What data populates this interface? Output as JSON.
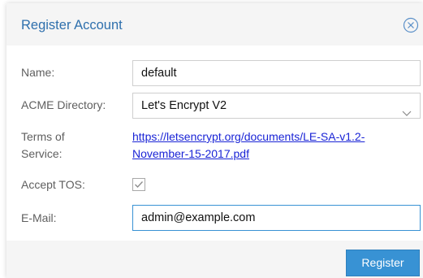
{
  "dialog": {
    "title": "Register Account",
    "close_icon": "close-circle-icon"
  },
  "form": {
    "name_label": "Name:",
    "name_value": "default",
    "acme_label": "ACME Directory:",
    "acme_value": "Let's Encrypt V2",
    "acme_arrow_icon": "chevron-down-icon",
    "tos_label_line1": "Terms of",
    "tos_label_line2": "Service:",
    "tos_link_line1": "https://letsencrypt.org/documents/LE-SA-v1.2-",
    "tos_link_line2": "November-15-2017.pdf",
    "accept_label": "Accept TOS:",
    "accept_checked": true,
    "email_label": "E-Mail:",
    "email_value": "admin@example.com"
  },
  "footer": {
    "register_label": "Register"
  },
  "colors": {
    "title": "#2f70ad",
    "link": "#1a24d6",
    "primary_button": "#3892d4",
    "focus_border": "#3892d4"
  }
}
